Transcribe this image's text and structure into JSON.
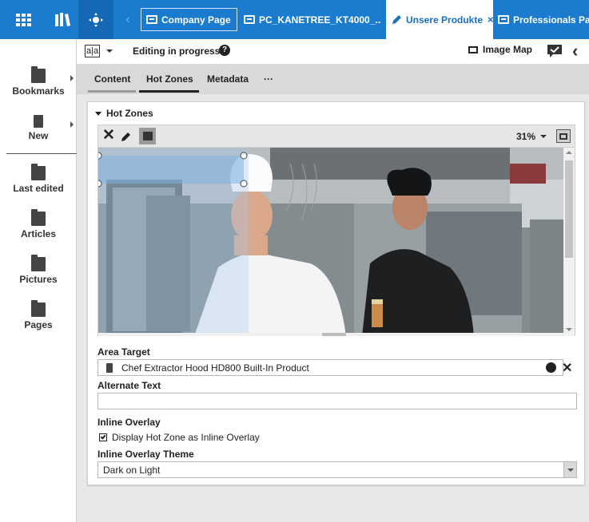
{
  "topbar": {
    "tabs": [
      {
        "label": "Company Page",
        "icon": "page-icon"
      },
      {
        "label": "PC_KANETREE_KT4000_...",
        "icon": "page-icon"
      },
      {
        "label": "Unsere Produkte",
        "icon": "pencil-icon",
        "close": "×"
      },
      {
        "label": "Professionals Pag",
        "icon": "page-icon"
      }
    ]
  },
  "header": {
    "language_icon": "a|a",
    "status": "Editing in progress",
    "image_map_label": "Image Map"
  },
  "sidebar": {
    "items": [
      {
        "label": "Bookmarks",
        "icon": "bookmark-folder-icon"
      },
      {
        "label": "New",
        "icon": "new-document-icon"
      },
      {
        "label": "Last edited",
        "icon": "search-folder-icon"
      },
      {
        "label": "Articles",
        "icon": "search-folder-icon"
      },
      {
        "label": "Pictures",
        "icon": "search-folder-icon"
      },
      {
        "label": "Pages",
        "icon": "search-folder-icon"
      }
    ]
  },
  "subtabs": {
    "items": [
      "Content",
      "Hot Zones",
      "Metadata",
      "···"
    ],
    "active": "Hot Zones"
  },
  "panel": {
    "section_title": "Hot Zones",
    "zoom": "31%",
    "area_target_label": "Area Target",
    "area_target_value": "Chef Extractor Hood HD800 Built-In Product",
    "alternate_text_label": "Alternate Text",
    "alternate_text_value": "",
    "inline_overlay_label": "Inline Overlay",
    "inline_overlay_checkbox": "Display Hot Zone as Inline Overlay",
    "inline_overlay_checked": true,
    "inline_overlay_theme_label": "Inline Overlay Theme",
    "inline_overlay_theme_value": "Dark on Light"
  },
  "colors": {
    "brand_blue": "#1a7bcf",
    "panel_bg": "#ffffff",
    "app_bg": "#e8e8e8"
  }
}
